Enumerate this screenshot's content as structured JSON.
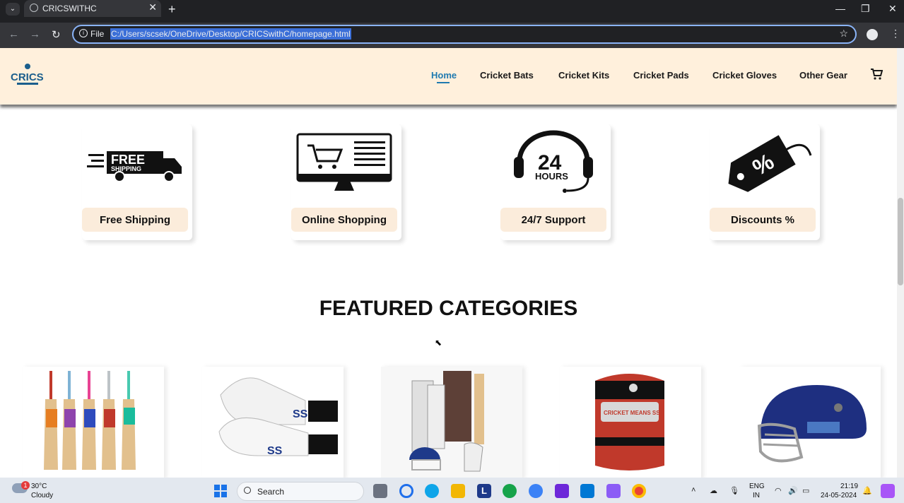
{
  "browser": {
    "tab_title": "CRICSWITHC",
    "tab_close": "✕",
    "new_tab": "+",
    "tab_list": "⌄",
    "omnibox_scheme_label": "File",
    "url": "C:/Users/scsek/OneDrive/Desktop/CRICSwithC/homepage.html",
    "back": "←",
    "forward": "→",
    "reload": "↻",
    "star": "☆",
    "menu": "⋮",
    "minimize": "—",
    "maximize": "❐",
    "close": "✕"
  },
  "header": {
    "logo_text": "CRICS",
    "nav": [
      {
        "label": "Home",
        "active": true
      },
      {
        "label": "Cricket Bats"
      },
      {
        "label": "Cricket Kits"
      },
      {
        "label": "Cricket Pads"
      },
      {
        "label": "Cricket Gloves"
      },
      {
        "label": "Other Gear"
      }
    ]
  },
  "features": [
    {
      "label": "Free Shipping",
      "icon": "truck-icon",
      "icon_text": "FREE",
      "icon_subtext": "SHIPPING"
    },
    {
      "label": "Online Shopping",
      "icon": "monitor-cart-icon"
    },
    {
      "label": "24/7 Support",
      "icon": "headset-icon",
      "icon_text": "24",
      "icon_subtext": "HOURS"
    },
    {
      "label": "Discounts %",
      "icon": "discount-tag-icon",
      "icon_text": "%"
    }
  ],
  "featured_title": "FEATURED CATEGORIES",
  "categories": [
    {
      "icon": "cricket-bats-image"
    },
    {
      "icon": "cricket-gloves-image",
      "icon_text": "SS"
    },
    {
      "icon": "cricket-kit-image"
    },
    {
      "icon": "cricket-kitbag-image",
      "icon_text": "CRICKET MEANS SS"
    },
    {
      "icon": "cricket-helmet-image"
    }
  ],
  "taskbar": {
    "weather_temp": "30°C",
    "weather_desc": "Cloudy",
    "weather_badge": "1",
    "search_placeholder": "Search",
    "lang_top": "ENG",
    "lang_bottom": "IN",
    "time": "21:19",
    "date": "24-05-2024"
  },
  "colors": {
    "header_bg": "#fff0dc",
    "nav_active": "#1f7ab0",
    "feature_label_bg": "#fbecdb"
  }
}
